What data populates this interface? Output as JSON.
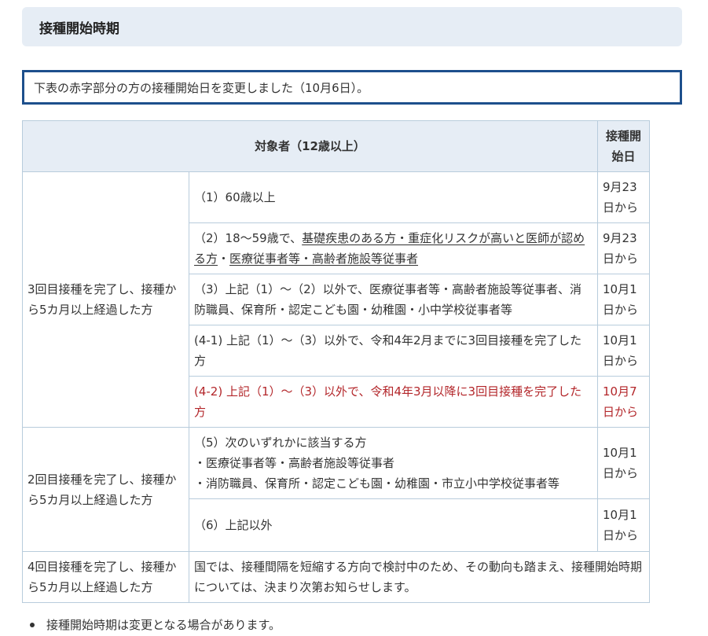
{
  "heading": "接種開始時期",
  "notice": "下表の赤字部分の方の接種開始日を変更しました（10月6日）。",
  "table": {
    "header_target": "対象者（12歳以上）",
    "header_date": "接種開始日",
    "group1_label": "3回目接種を完了し、接種から5カ月以上経過した方",
    "row1": {
      "text": "（1）60歳以上",
      "date": "9月23日から"
    },
    "row2": {
      "prefix": "（2）18〜59歳で、",
      "link1": "基礎疾患のある方・重症化リスクが高いと医師が認める方",
      "sep": "・",
      "link2": "医療従事者等・高齢者施設等従事者",
      "date": "9月23日から"
    },
    "row3": {
      "text": "（3）上記（1）〜（2）以外で、医療従事者等・高齢者施設等従事者、消防職員、保育所・認定こども園・幼稚園・小中学校従事者等",
      "date": "10月1日から"
    },
    "row4": {
      "text": "(4-1) 上記（1）〜（3）以外で、令和4年2月までに3回目接種を完了した方",
      "date": "10月1日から"
    },
    "row5": {
      "text": "(4-2) 上記（1）〜（3）以外で、令和4年3月以降に3回目接種を完了した方",
      "date": "10月7日から"
    },
    "group2_label": "2回目接種を完了し、接種から5カ月以上経過した方",
    "row6": {
      "line1": "（5）次のいずれかに該当する方",
      "line2": "・医療従事者等・高齢者施設等従事者",
      "line3": "・消防職員、保育所・認定こども園・幼稚園・市立小中学校従事者等",
      "date": "10月1日から"
    },
    "row7": {
      "text": "（6）上記以外",
      "date": "10月1日から"
    },
    "group3_label": "4回目接種を完了し、接種から5カ月以上経過した方",
    "group3_text": "国では、接種間隔を短縮する方向で検討中のため、その動向も踏まえ、接種開始時期については、決まり次第お知らせします。"
  },
  "note": "接種開始時期は変更となる場合があります。",
  "colors": {
    "accent_red": "#b3262a",
    "border_blue": "#1d4f8c",
    "header_bg": "#e6edf5"
  }
}
